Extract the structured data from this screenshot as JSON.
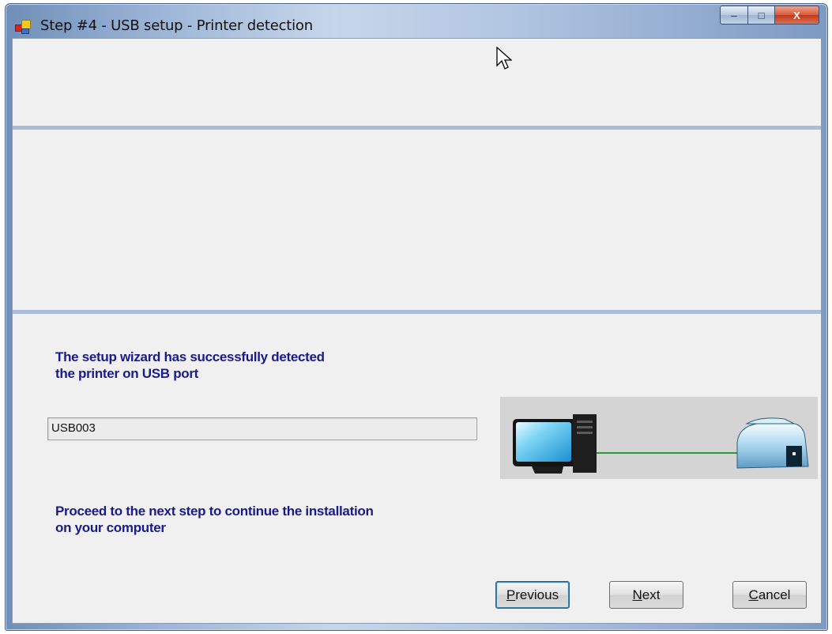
{
  "window": {
    "title": "Step #4 - USB setup - Printer detection",
    "buttons": {
      "minimize": "–",
      "maximize": "□",
      "close": "X"
    }
  },
  "content": {
    "detected_message": [
      "The setup wizard has successfully detected",
      "the printer on USB port"
    ],
    "port_value": "USB003",
    "proceed_message": [
      "Proceed to the next step to continue the installation",
      "on your computer"
    ]
  },
  "buttons": {
    "previous": {
      "first": "P",
      "rest": "revious"
    },
    "next": {
      "first": "N",
      "rest": "ext"
    },
    "cancel": {
      "first": "C",
      "rest": "ancel"
    }
  },
  "icons": [
    "app-icon",
    "computer-icon",
    "printer-icon",
    "mouse-cursor-icon"
  ],
  "colors": {
    "message_text": "#1a1a8c",
    "divider": "#a9bcd9",
    "connection_line": "#2a9a3a"
  }
}
